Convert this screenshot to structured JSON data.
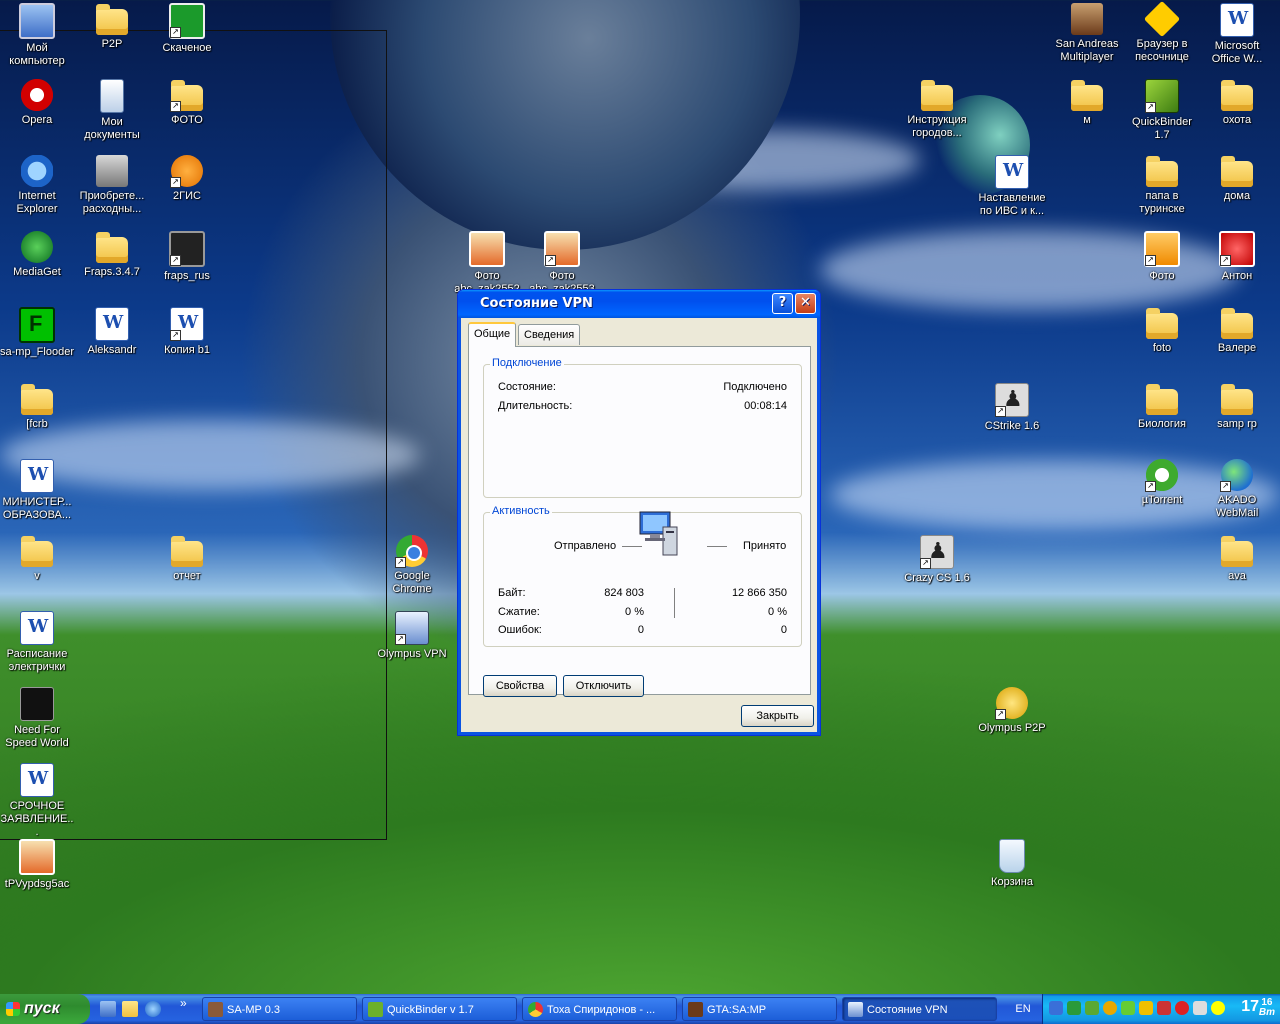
{
  "desktop_icons": [
    {
      "label": "Мой компьютер",
      "kind": "comp"
    },
    {
      "label": "P2P",
      "kind": "folder"
    },
    {
      "label": "Скаченое",
      "kind": "arrow-green"
    },
    {
      "label": "Opera",
      "kind": "opera"
    },
    {
      "label": "Мои документы",
      "kind": "mydocs"
    },
    {
      "label": "ФОТО",
      "kind": "folder"
    },
    {
      "label": "Internet Explorer",
      "kind": "ie"
    },
    {
      "label": "Приобрете... расходны...",
      "kind": "printer"
    },
    {
      "label": "2ГИС",
      "kind": "orange"
    },
    {
      "label": "MediaGet",
      "kind": "mediaget"
    },
    {
      "label": "Fraps.3.4.7",
      "kind": "folder"
    },
    {
      "label": "fraps_rus",
      "kind": "fraps"
    },
    {
      "label": "sa-mp_Flooder",
      "kind": "green-f"
    },
    {
      "label": "Aleksandr",
      "kind": "word"
    },
    {
      "label": "Копия b1",
      "kind": "word"
    },
    {
      "label": "[fcrb",
      "kind": "folder"
    },
    {
      "label": "МИНИСТЕР... ОБРАЗОВА...",
      "kind": "word"
    },
    {
      "label": "v",
      "kind": "folder"
    },
    {
      "label": "отчет",
      "kind": "folder"
    },
    {
      "label": "Расписание электрички",
      "kind": "word"
    },
    {
      "label": "Need For Speed World",
      "kind": "nfs"
    },
    {
      "label": "СРОЧНОЕ ЗАЯВЛЕНИЕ...",
      "kind": "word"
    },
    {
      "label": "tPVypdsg5ac",
      "kind": "photo"
    },
    {
      "label": "Фото abc_zak2552",
      "kind": "photo"
    },
    {
      "label": "Фото abc_zak2553",
      "kind": "photo"
    },
    {
      "label": "Google Chrome",
      "kind": "chrome"
    },
    {
      "label": "Olympus VPN",
      "kind": "vpn"
    },
    {
      "label": "Инструкция городов...",
      "kind": "folder"
    },
    {
      "label": "Наставление по ИВС и к...",
      "kind": "word"
    },
    {
      "label": "CStrike 1.6",
      "kind": "cstrike"
    },
    {
      "label": "Crazy CS 1.6",
      "kind": "cstrike"
    },
    {
      "label": "Olympus P2P",
      "kind": "ols"
    },
    {
      "label": "Корзина",
      "kind": "bin"
    },
    {
      "label": "San Andreas Multiplayer",
      "kind": "samp"
    },
    {
      "label": "Браузер в песочнице",
      "kind": "browser-sb"
    },
    {
      "label": "Microsoft Office W...",
      "kind": "word"
    },
    {
      "label": "м",
      "kind": "folder"
    },
    {
      "label": "QuickBinder 1.7",
      "kind": "qb"
    },
    {
      "label": "охота",
      "kind": "folder"
    },
    {
      "label": "папа в туринске",
      "kind": "folder"
    },
    {
      "label": "дома",
      "kind": "folder"
    },
    {
      "label": "Фото",
      "kind": "key"
    },
    {
      "label": "Антон",
      "kind": "power"
    },
    {
      "label": "foto",
      "kind": "folder"
    },
    {
      "label": "Валере",
      "kind": "folder"
    },
    {
      "label": "Биология",
      "kind": "folder"
    },
    {
      "label": "samp rp",
      "kind": "folder"
    },
    {
      "label": "µTorrent",
      "kind": "utorrent"
    },
    {
      "label": "AKADO WebMail",
      "kind": "globe"
    },
    {
      "label": "ava",
      "kind": "folder"
    }
  ],
  "dialog": {
    "title": "Состояние VPN",
    "help_glyph": "?",
    "close_glyph": "✕",
    "tabs": [
      "Общие",
      "Сведения"
    ],
    "connection": {
      "group_title": "Подключение",
      "status_label": "Состояние:",
      "status_value": "Подключено",
      "duration_label": "Длительность:",
      "duration_value": "00:08:14"
    },
    "activity": {
      "group_title": "Активность",
      "sent_label": "Отправлено",
      "received_label": "Принято",
      "bytes_label": "Байт:",
      "bytes_sent": "824 803",
      "bytes_received": "12 866 350",
      "compression_label": "Сжатие:",
      "compression_sent": "0 %",
      "compression_received": "0 %",
      "errors_label": "Ошибок:",
      "errors_sent": "0",
      "errors_received": "0"
    },
    "properties_button": "Свойства",
    "disconnect_button": "Отключить",
    "close_button": "Закрыть"
  },
  "taskbar": {
    "start_label": "пуск",
    "chevron": "»",
    "tasks": [
      {
        "label": "SA-MP 0.3"
      },
      {
        "label": "QuickBinder v 1.7"
      },
      {
        "label": "Тоха Спиридонов - ..."
      },
      {
        "label": "GTA:SA:MP"
      },
      {
        "label": "Состояние VPN"
      }
    ],
    "language": "EN",
    "clock_hours": "17",
    "clock_minutes": "16",
    "clock_day": "Вт"
  }
}
